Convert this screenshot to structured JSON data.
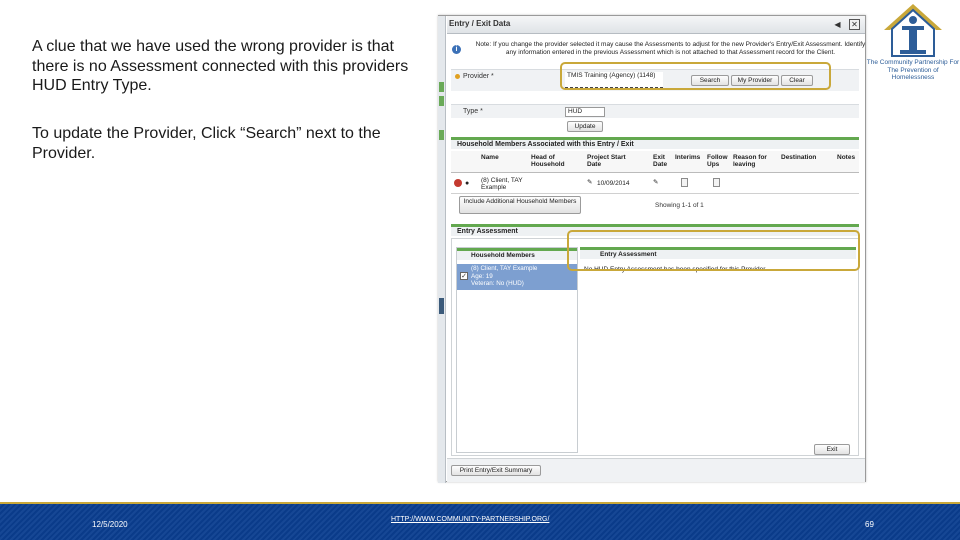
{
  "slide": {
    "paragraph1": "A clue that we have used the wrong provider is that there is no Assessment connected with this providers HUD Entry Type.",
    "paragraph2": "To update the Provider, Click “Search” next to the Provider."
  },
  "window": {
    "title": "Entry / Exit Data",
    "note": "Note: If you change the provider selected it may cause the Assessments to adjust for the new Provider's Entry/Exit Assessment. Identify any information entered in the previous Assessment which is not attached to that Assessment record for the Client.",
    "provider_label": "Provider *",
    "provider_value": "TMIS Training (Agency) (1148)",
    "search_button": "Search",
    "my_provider_button": "My Provider",
    "clear_button": "Clear",
    "type_label": "Type *",
    "type_value": "HUD",
    "update_button": "Update",
    "household_section": "Household Members Associated with this Entry / Exit",
    "columns": {
      "name": "Name",
      "head_of_household": "Head of Household",
      "project_start": "Project Start Date",
      "exit_date": "Exit Date",
      "interims": "Interims",
      "follow_ups": "Follow Ups",
      "reason_for_leaving": "Reason for leaving",
      "destination": "Destination",
      "notes": "Notes"
    },
    "row": {
      "name": "(8) Client, TAY Example",
      "start_date": "10/09/2014"
    },
    "include_button": "Include Additional Household Members",
    "showing": "Showing 1-1 of 1",
    "entry_assessment_section": "Entry Assessment",
    "household_members_header": "Household Members",
    "entry_assessment_header": "Entry Assessment",
    "member_line1": "(8) Client, TAY Example",
    "member_line2": "Age: 19",
    "member_line3": "Veteran: No (HUD)",
    "no_assessment_msg": "No HUD Entry Assessment has been specified for this Provider",
    "exit_button": "Exit",
    "print_button": "Print Entry/Exit Summary"
  },
  "logo": {
    "text": "The Community Partnership For The Prevention of Homelessness"
  },
  "footer": {
    "date": "12/5/2020",
    "url": "HTTP://WWW.COMMUNITY-PARTNERSHIP.ORG/",
    "page": "69"
  },
  "colors": {
    "footer_bar": "#0a3d8f",
    "highlight": "#c9a83a",
    "section_green": "#63a84f",
    "selection_blue": "#7d9fd0"
  },
  "icons": [
    "help-icon",
    "close-icon",
    "info-icon",
    "delete-icon",
    "pencil-icon",
    "document-icon",
    "checkbox-icon",
    "logo-house-icon"
  ]
}
